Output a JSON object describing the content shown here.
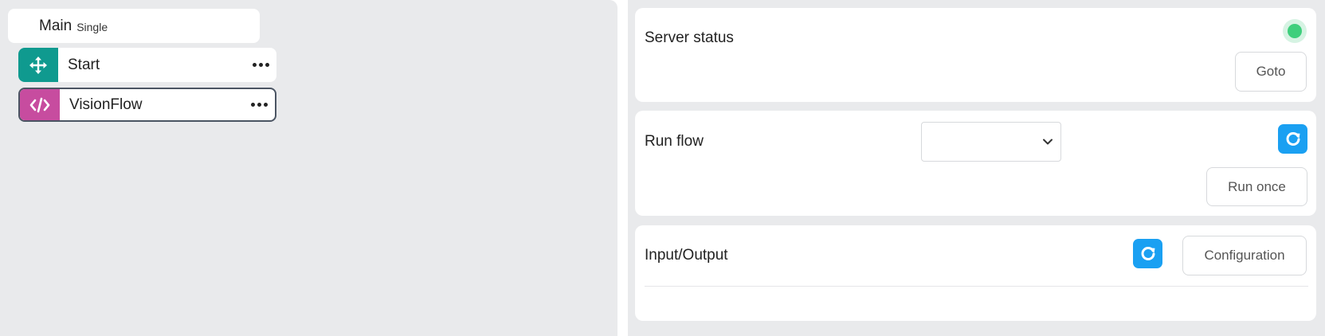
{
  "flow": {
    "header": {
      "title": "Main",
      "subtitle": "Single"
    },
    "nodes": [
      {
        "label": "Start",
        "icon": "move-arrows-icon",
        "color": "#0f9a8f"
      },
      {
        "label": "VisionFlow",
        "icon": "code-icon",
        "color": "#c74c9f",
        "selected": true
      }
    ]
  },
  "server": {
    "title": "Server status",
    "status_color": "#3ecf7c",
    "goto_label": "Goto"
  },
  "run": {
    "title": "Run flow",
    "selected_flow": "",
    "run_once_label": "Run once",
    "refresh_icon": "refresh-icon"
  },
  "io": {
    "title": "Input/Output",
    "configuration_label": "Configuration",
    "refresh_icon": "refresh-icon"
  },
  "colors": {
    "accent": "#1aa0f2",
    "background": "#e9eaec"
  }
}
